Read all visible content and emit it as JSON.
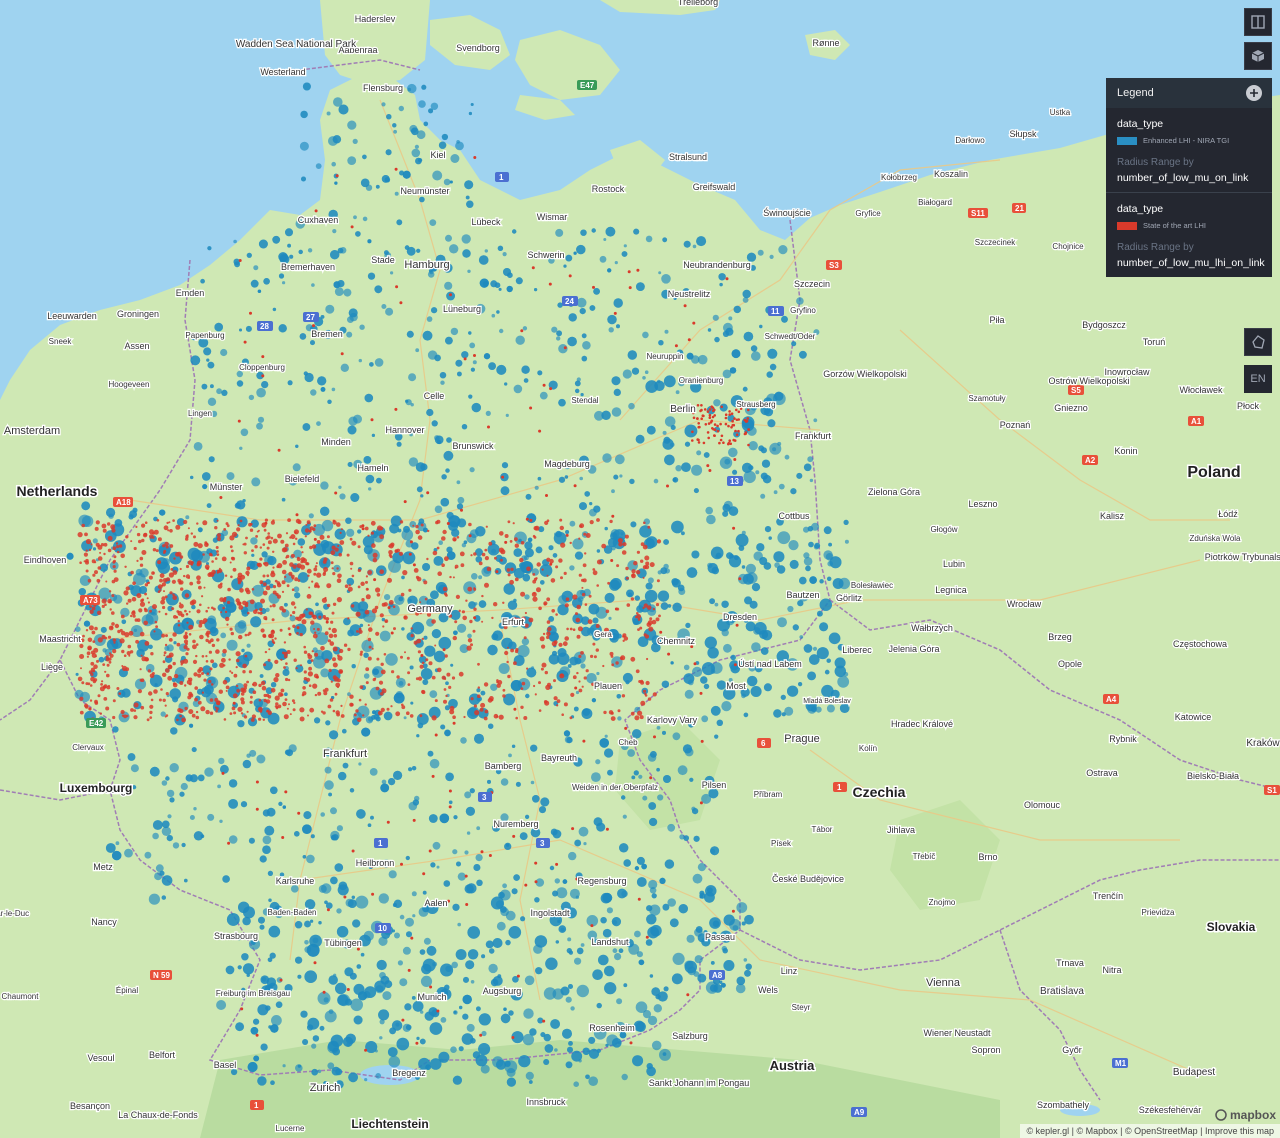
{
  "colors": {
    "water": "#9fd3f0",
    "land": "#cfe8b4",
    "land_alt": "#bfe0a2",
    "forest": "#a9d48e",
    "border": "#a07db5",
    "enhanced": "#1f8bbf",
    "state_of_art": "#d93a2b",
    "motorway": "#e8503a",
    "federal": "#4b6fd1"
  },
  "legend": {
    "title": "Legend",
    "layers": [
      {
        "field": "data_type",
        "value": "Enhanced LHI - NIRA TGI",
        "color": "#2a8fc3",
        "radius_label": "Radius Range by",
        "radius_field": "number_of_low_mu_on_link"
      },
      {
        "field": "data_type",
        "value": "State of the art LHI",
        "color": "#d93a2b",
        "radius_label": "Radius Range by",
        "radius_field": "number_of_low_mu_lhi_on_link"
      }
    ]
  },
  "toolbar": {
    "split_icon": "split-map-icon",
    "layers_icon": "layers-icon",
    "draw_icon": "draw-polygon-icon",
    "lang_label": "EN"
  },
  "attribution": {
    "mapbox_logo": "mapbox",
    "items": "© kepler.gl | © Mapbox | © OpenStreetMap | Improve this map"
  },
  "map": {
    "countries": [
      {
        "name": "Netherlands"
      },
      {
        "name": "Poland"
      },
      {
        "name": "Czechia"
      },
      {
        "name": "Austria"
      },
      {
        "name": "Slovakia"
      },
      {
        "name": "Luxembourg"
      },
      {
        "name": "Liechtenstein"
      }
    ],
    "cities": [
      {
        "name": "Haderslev"
      },
      {
        "name": "Aabenraa"
      },
      {
        "name": "Svendborg"
      },
      {
        "name": "Trelleborg"
      },
      {
        "name": "Rønne"
      },
      {
        "name": "Westerland"
      },
      {
        "name": "Wadden Sea National Park"
      },
      {
        "name": "Flensburg"
      },
      {
        "name": "Kiel"
      },
      {
        "name": "Neumünster"
      },
      {
        "name": "Stralsund"
      },
      {
        "name": "Greifswald"
      },
      {
        "name": "Rostock"
      },
      {
        "name": "Cuxhaven"
      },
      {
        "name": "Lübeck"
      },
      {
        "name": "Wismar"
      },
      {
        "name": "Schwerin"
      },
      {
        "name": "Stade"
      },
      {
        "name": "Hamburg"
      },
      {
        "name": "Bremerhaven"
      },
      {
        "name": "Neubrandenburg"
      },
      {
        "name": "Neustrelitz"
      },
      {
        "name": "Szczecin"
      },
      {
        "name": "Gryfino"
      },
      {
        "name": "Schwedt/Oder"
      },
      {
        "name": "Emden"
      },
      {
        "name": "Leeuwarden"
      },
      {
        "name": "Groningen"
      },
      {
        "name": "Assen"
      },
      {
        "name": "Sneek"
      },
      {
        "name": "Hoogeveen"
      },
      {
        "name": "Papenburg"
      },
      {
        "name": "Cloppenburg"
      },
      {
        "name": "Bremen"
      },
      {
        "name": "Lüneburg"
      },
      {
        "name": "Celle"
      },
      {
        "name": "Stendal"
      },
      {
        "name": "Neuruppin"
      },
      {
        "name": "Oranienburg"
      },
      {
        "name": "Berlin"
      },
      {
        "name": "Strausberg"
      },
      {
        "name": "Frankfurt"
      },
      {
        "name": "Amsterdam"
      },
      {
        "name": "Lingen"
      },
      {
        "name": "Minden"
      },
      {
        "name": "Hannover"
      },
      {
        "name": "Brunswick"
      },
      {
        "name": "Magdeburg"
      },
      {
        "name": "Hameln"
      },
      {
        "name": "Münster"
      },
      {
        "name": "Bielefeld"
      },
      {
        "name": "Eindhoven"
      },
      {
        "name": "Cottbus"
      },
      {
        "name": "Germany"
      },
      {
        "name": "Erfurt"
      },
      {
        "name": "Gera"
      },
      {
        "name": "Chemnitz"
      },
      {
        "name": "Dresden"
      },
      {
        "name": "Bautzen"
      },
      {
        "name": "Görlitz"
      },
      {
        "name": "Maastricht"
      },
      {
        "name": "Liège"
      },
      {
        "name": "Plauen"
      },
      {
        "name": "Ústí nad Labem"
      },
      {
        "name": "Liberec"
      },
      {
        "name": "Most"
      },
      {
        "name": "Karlovy Vary"
      },
      {
        "name": "Cheb"
      },
      {
        "name": "Mladá Boleslav"
      },
      {
        "name": "Prague"
      },
      {
        "name": "Hradec Králové"
      },
      {
        "name": "Kolín"
      },
      {
        "name": "Pilsen"
      },
      {
        "name": "Příbram"
      },
      {
        "name": "Frankfurt"
      },
      {
        "name": "Bamberg"
      },
      {
        "name": "Bayreuth"
      },
      {
        "name": "Weiden in der Oberpfalz"
      },
      {
        "name": "Nuremberg"
      },
      {
        "name": "Regensburg"
      },
      {
        "name": "Luxembourg"
      },
      {
        "name": "Clervaux"
      },
      {
        "name": "Metz"
      },
      {
        "name": "Karlsruhe"
      },
      {
        "name": "Heilbronn"
      },
      {
        "name": "Baden-Baden"
      },
      {
        "name": "Strasbourg"
      },
      {
        "name": "Tübingen"
      },
      {
        "name": "Aalen"
      },
      {
        "name": "Ingolstadt"
      },
      {
        "name": "Landshut"
      },
      {
        "name": "Passau"
      },
      {
        "name": "Augsburg"
      },
      {
        "name": "Munich"
      },
      {
        "name": "Rosenheim"
      },
      {
        "name": "Salzburg"
      },
      {
        "name": "Linz"
      },
      {
        "name": "Wels"
      },
      {
        "name": "Steyr"
      },
      {
        "name": "Vienna"
      },
      {
        "name": "Bratislava"
      },
      {
        "name": "Wiener Neustadt"
      },
      {
        "name": "Sopron"
      },
      {
        "name": "Győr"
      },
      {
        "name": "Budapest"
      },
      {
        "name": "Nancy"
      },
      {
        "name": "Épinal"
      },
      {
        "name": "Freiburg im Breisgau"
      },
      {
        "name": "Belfort"
      },
      {
        "name": "Vesoul"
      },
      {
        "name": "Basel"
      },
      {
        "name": "Zurich"
      },
      {
        "name": "Bregenz"
      },
      {
        "name": "Innsbruck"
      },
      {
        "name": "Sankt Johann im Pongau"
      },
      {
        "name": "Besançon"
      },
      {
        "name": "La Chaux-de-Fonds"
      },
      {
        "name": "Lucerne"
      },
      {
        "name": "Bar-le-Duc"
      },
      {
        "name": "Chaumont"
      },
      {
        "name": "České Budějovice"
      },
      {
        "name": "Písek"
      },
      {
        "name": "Tábor"
      },
      {
        "name": "Jihlava"
      },
      {
        "name": "Třebíč"
      },
      {
        "name": "Brno"
      },
      {
        "name": "Znojmo"
      },
      {
        "name": "Trenčín"
      },
      {
        "name": "Prievidza"
      },
      {
        "name": "Trnava"
      },
      {
        "name": "Nitra"
      },
      {
        "name": "Olomouc"
      },
      {
        "name": "Ostrava"
      },
      {
        "name": "Bielsko-Biała"
      },
      {
        "name": "Rybnik"
      },
      {
        "name": "Katowice"
      },
      {
        "name": "Kraków"
      },
      {
        "name": "Opole"
      },
      {
        "name": "Częstochowa"
      },
      {
        "name": "Brzeg"
      },
      {
        "name": "Wrocław"
      },
      {
        "name": "Legnica"
      },
      {
        "name": "Lubin"
      },
      {
        "name": "Jelenia Góra"
      },
      {
        "name": "Wałbrzych"
      },
      {
        "name": "Bolesławiec"
      },
      {
        "name": "Zielona Góra"
      },
      {
        "name": "Głogów"
      },
      {
        "name": "Leszno"
      },
      {
        "name": "Kalisz"
      },
      {
        "name": "Ostrów Wielkopolski"
      },
      {
        "name": "Zduńska Wola"
      },
      {
        "name": "Łódź"
      },
      {
        "name": "Piotrków Trybunalski"
      },
      {
        "name": "Konin"
      },
      {
        "name": "Poznań"
      },
      {
        "name": "Gniezno"
      },
      {
        "name": "Gorzów Wielkopolski"
      },
      {
        "name": "Szamotuły"
      },
      {
        "name": "Inowrocław"
      },
      {
        "name": "Bydgoszcz"
      },
      {
        "name": "Toruń"
      },
      {
        "name": "Włocławek"
      },
      {
        "name": "Płock"
      },
      {
        "name": "Piła"
      },
      {
        "name": "Chojnice"
      },
      {
        "name": "Szczecinek"
      },
      {
        "name": "Białogard"
      },
      {
        "name": "Koszalin"
      },
      {
        "name": "Kołobrzeg"
      },
      {
        "name": "Słupsk"
      },
      {
        "name": "Darłowo"
      },
      {
        "name": "Gryfice"
      },
      {
        "name": "Świnoujście"
      },
      {
        "name": "Ustka"
      },
      {
        "name": "Székesfehérvár"
      },
      {
        "name": "Szombathely"
      }
    ]
  }
}
